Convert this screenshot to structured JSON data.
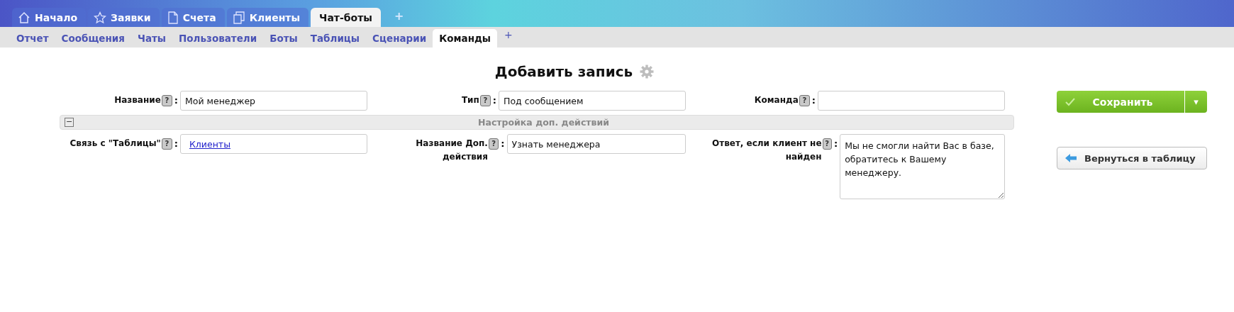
{
  "top_tabs": [
    {
      "label": "Начало",
      "selected": false
    },
    {
      "label": "Заявки",
      "selected": false
    },
    {
      "label": "Счета",
      "selected": false
    },
    {
      "label": "Клиенты",
      "selected": false
    },
    {
      "label": "Чат-боты",
      "selected": true
    }
  ],
  "top_add": "+",
  "sub_tabs": [
    {
      "label": "Отчет",
      "selected": false
    },
    {
      "label": "Сообщения",
      "selected": false
    },
    {
      "label": "Чаты",
      "selected": false
    },
    {
      "label": "Пользователи",
      "selected": false
    },
    {
      "label": "Боты",
      "selected": false
    },
    {
      "label": "Таблицы",
      "selected": false
    },
    {
      "label": "Сценарии",
      "selected": false
    },
    {
      "label": "Команды",
      "selected": true
    }
  ],
  "sub_add": "+",
  "title": "Добавить запись",
  "help_mark": "?",
  "row1": [
    {
      "label": "Название",
      "colon": ":",
      "kind": "input",
      "value": "Мой менеджер"
    },
    {
      "label": "Тип",
      "colon": ":",
      "kind": "input",
      "value": "Под сообщением"
    },
    {
      "label": "Команда",
      "colon": ":",
      "kind": "input"
    }
  ],
  "section": {
    "title": "Настройка доп. действий",
    "toggle": "−",
    "expanded": true
  },
  "row2": [
    {
      "label": "Связь с \"Таблицы\"",
      "colon": ":",
      "kind": "link",
      "value": "Клиенты"
    },
    {
      "label": "Название Доп. действия",
      "colon": ":",
      "kind": "input",
      "value": "Узнать менеджера"
    },
    {
      "label": "Ответ, если клиент не найден",
      "colon": ":",
      "kind": "textarea",
      "value": "Мы не смогли найти Вас в базе,\nобратитесь к Вашему менеджеру."
    }
  ],
  "save_button": {
    "label": "Сохранить",
    "caret": "▾"
  },
  "back_button": {
    "label": "Вернуться в таблицу"
  }
}
